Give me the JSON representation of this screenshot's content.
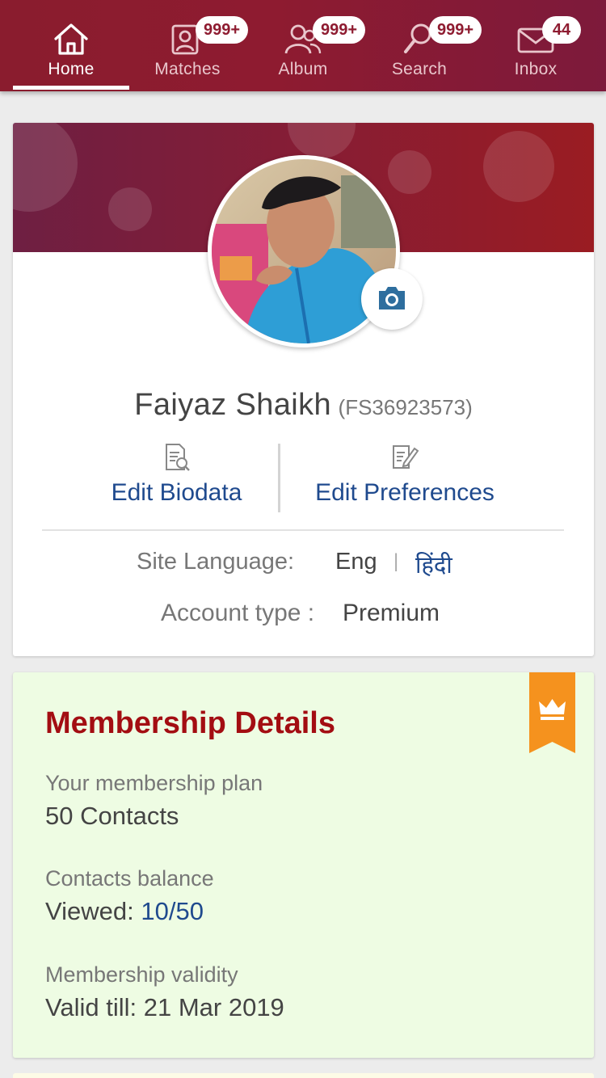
{
  "nav": {
    "home": {
      "label": "Home",
      "icon": "home-icon"
    },
    "matches": {
      "label": "Matches",
      "icon": "matches-icon",
      "badge": "999+"
    },
    "album": {
      "label": "Album",
      "icon": "album-icon",
      "badge": "999+"
    },
    "search": {
      "label": "Search",
      "icon": "search-icon",
      "badge": "999+"
    },
    "inbox": {
      "label": "Inbox",
      "icon": "inbox-icon",
      "badge": "44"
    }
  },
  "profile": {
    "name": "Faiyaz Shaikh",
    "id": "(FS36923573)",
    "edit_biodata": "Edit Biodata",
    "edit_preferences": "Edit Preferences",
    "site_language_label": "Site Language:",
    "lang_eng": "Eng",
    "lang_separator": "|",
    "lang_hindi": "हिंदी",
    "account_type_label": "Account type :",
    "account_type_value": "Premium"
  },
  "membership": {
    "title": "Membership Details",
    "plan_label": "Your membership plan",
    "plan_value": "50 Contacts",
    "balance_label": "Contacts balance",
    "viewed_prefix": "Viewed:",
    "viewed_value": "10/50",
    "validity_label": "Membership validity",
    "validity_value": "Valid till: 21 Mar 2019"
  },
  "colors": {
    "brand": "#8e1b30",
    "link": "#1f4a8e",
    "membership_title": "#a30d12",
    "membership_bg": "#eefce3",
    "ribbon": "#f5921e"
  }
}
